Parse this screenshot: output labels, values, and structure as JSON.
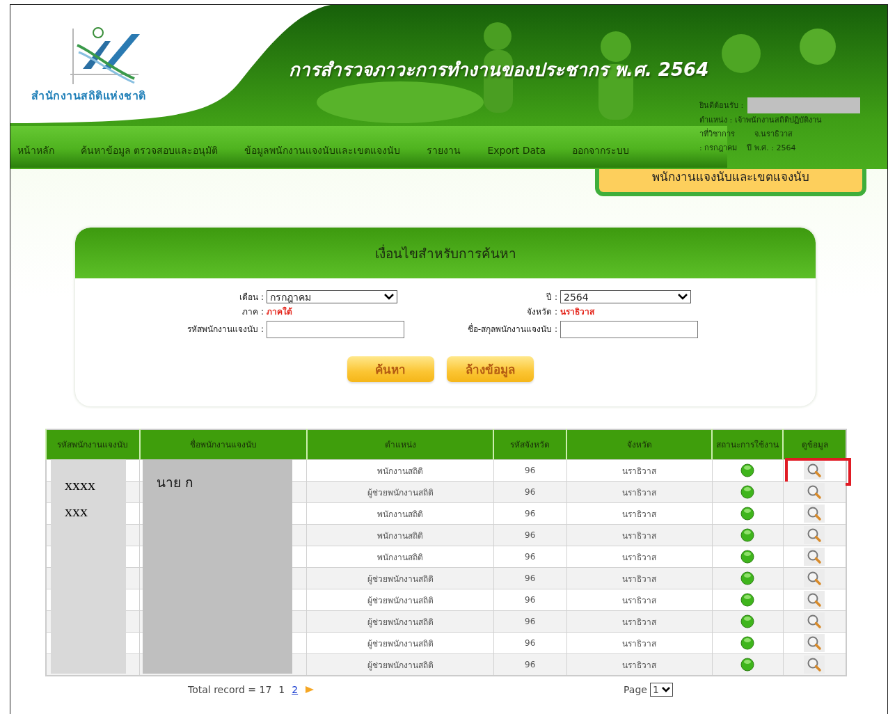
{
  "header": {
    "logo_text": "สำนักงานสถิติแห่งชาติ",
    "title": "การสำรวจภาวะการทำงานของประชากร พ.ศ. 2564",
    "user_info": {
      "welcome_label": "ยินดีต้อนรับ :",
      "position": "ตำแหน่ง : เจ้าพนักงานสถิติปฏิบัติงาน",
      "duty": "าที่วิชาการ",
      "province": "จ.นราธิวาส",
      "month": ": กรกฎาคม",
      "year": "ปี พ.ศ. : 2564"
    }
  },
  "nav": [
    "หน้าหลัก",
    "ค้นหาข้อมูล ตรวจสอบและอนุมัติ",
    "ข้อมูลพนักงานแจงนับและเขตแจงนับ",
    "รายงาน",
    "Export Data",
    "ออกจากระบบ"
  ],
  "page_tab": "พนักงานแจงนับและเขตแจงนับ",
  "search_panel": {
    "title": "เงื่อนไขสำหรับการค้นหา",
    "fields": [
      {
        "kind": "select",
        "label": "เดือน :",
        "value": "กรกฎาคม"
      },
      {
        "kind": "select",
        "label": "ปี :",
        "value": "2564"
      },
      {
        "kind": "readout",
        "label": "ภาค :",
        "value": "ภาคใต้"
      },
      {
        "kind": "readout",
        "label": "จังหวัด :",
        "value": "นราธิวาส"
      },
      {
        "kind": "input",
        "label": "รหัสพนักงานแจงนับ :"
      },
      {
        "kind": "input",
        "label": "ชื่อ-สกุลพนักงานแจงนับ :"
      }
    ],
    "buttons": [
      "ค้นหา",
      "ล้างข้อมูล"
    ]
  },
  "table": {
    "columns": [
      "รหัสพนักงานแจงนับ",
      "ชื่อพนักงานแจงนับ",
      "ตำแหน่ง",
      "รหัสจังหวัด",
      "จังหวัด",
      "สถานะการใช้งาน",
      "ดูข้อมูล"
    ],
    "redacted_code": "xxxx xxx",
    "redacted_name": "นาย ก",
    "rows": [
      {
        "position": "พนักงานสถิติ",
        "province_code": "96",
        "province": "นราธิวาส",
        "active": true,
        "highlighted": true
      },
      {
        "position": "ผู้ช่วยพนักงานสถิติ",
        "province_code": "96",
        "province": "นราธิวาส",
        "active": true,
        "highlighted": false
      },
      {
        "position": "พนักงานสถิติ",
        "province_code": "96",
        "province": "นราธิวาส",
        "active": true,
        "highlighted": false
      },
      {
        "position": "พนักงานสถิติ",
        "province_code": "96",
        "province": "นราธิวาส",
        "active": true,
        "highlighted": false
      },
      {
        "position": "พนักงานสถิติ",
        "province_code": "96",
        "province": "นราธิวาส",
        "active": true,
        "highlighted": false
      },
      {
        "position": "ผู้ช่วยพนักงานสถิติ",
        "province_code": "96",
        "province": "นราธิวาส",
        "active": true,
        "highlighted": false
      },
      {
        "position": "ผู้ช่วยพนักงานสถิติ",
        "province_code": "96",
        "province": "นราธิวาส",
        "active": true,
        "highlighted": false
      },
      {
        "position": "ผู้ช่วยพนักงานสถิติ",
        "province_code": "96",
        "province": "นราธิวาส",
        "active": true,
        "highlighted": false
      },
      {
        "position": "ผู้ช่วยพนักงานสถิติ",
        "province_code": "96",
        "province": "นราธิวาส",
        "active": true,
        "highlighted": false
      },
      {
        "position": "ผู้ช่วยพนักงานสถิติ",
        "province_code": "96",
        "province": "นราธิวาส",
        "active": true,
        "highlighted": false
      }
    ]
  },
  "pager": {
    "total": "Total record = 17",
    "pages": [
      {
        "label": "1",
        "selected": true
      },
      {
        "label": "2",
        "selected": false
      }
    ],
    "page_label": "Page",
    "page_value": "1"
  }
}
